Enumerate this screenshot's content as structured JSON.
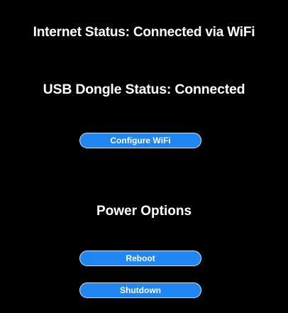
{
  "status": {
    "internet": "Internet Status: Connected via WiFi",
    "usb_dongle": "USB Dongle Status: Connected"
  },
  "actions": {
    "configure_wifi_label": "Configure WiFi"
  },
  "power": {
    "title": "Power Options",
    "reboot_label": "Reboot",
    "shutdown_label": "Shutdown"
  },
  "colors": {
    "background": "#000000",
    "text": "#ffffff",
    "button_fill": "#1f86f4",
    "button_border": "#cfe6ff"
  }
}
